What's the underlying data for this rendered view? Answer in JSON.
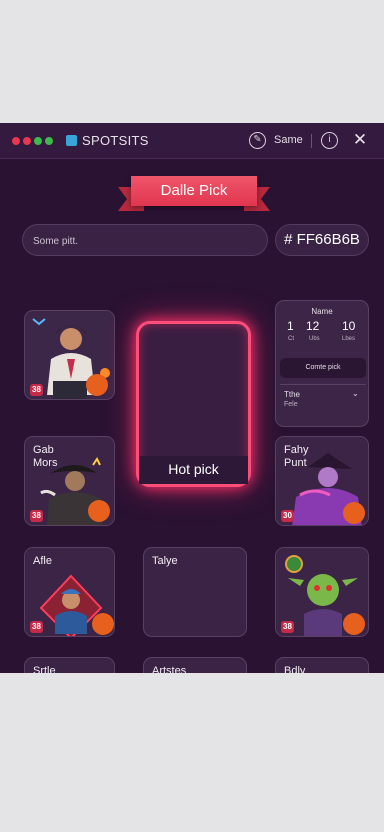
{
  "titlebar": {
    "brand": "SPOTSITS",
    "right_label": "Same",
    "dots": [
      "#e8384f",
      "#e8384f",
      "#3dbb4a",
      "#3dbb4a"
    ]
  },
  "banner": {
    "title": "Dalle Pick"
  },
  "search": {
    "placeholder": "Some pitt."
  },
  "hex_value": "# FF66B6B",
  "grid": {
    "card1": {
      "label": "",
      "badge": "38"
    },
    "card2": {
      "label": "Gab Mors",
      "badge": "38"
    },
    "card3": {
      "label": "Fahy Punt",
      "badge": "30"
    },
    "card4": {
      "label": "Afle",
      "badge": "38"
    },
    "card5": {
      "label": "Talye"
    },
    "card6": {
      "label": "",
      "badge": "38"
    },
    "bottom": [
      "Srtle",
      "Artstes",
      "Bdly"
    ]
  },
  "hot_pick": {
    "label": "Hot pick"
  },
  "panel": {
    "title": "Name",
    "stats": [
      {
        "value": "1",
        "label": "Ct"
      },
      {
        "value": "12",
        "label": "Ubs"
      },
      {
        "value": "10",
        "label": "Lbes"
      }
    ],
    "button": "Comte pick",
    "select_label": "Tthe",
    "select_sub": "Fele"
  },
  "colors": {
    "accent": "#ff4d7a",
    "bg": "#2a1233",
    "ribbon": "#e8405a"
  }
}
